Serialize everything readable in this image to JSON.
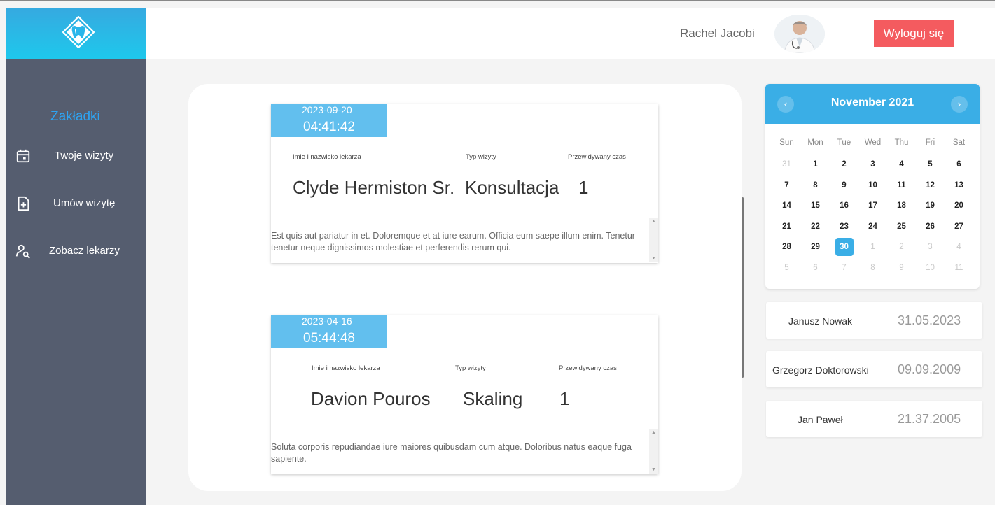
{
  "header": {
    "user_name": "Rachel Jacobi",
    "logout_label": "Wyloguj się"
  },
  "sidebar": {
    "title": "Zakładki",
    "items": [
      {
        "label": "Twoje wizyty",
        "icon": "calendar-icon"
      },
      {
        "label": "Umów wizytę",
        "icon": "file-add-icon"
      },
      {
        "label": "Zobacz lekarzy",
        "icon": "user-search-icon"
      }
    ]
  },
  "visits": [
    {
      "date": "2023-09-20",
      "time": "04:41:42",
      "doctor_header": "Imie i nazwisko lekarza",
      "type_header": "Typ wizyty",
      "duration_header": "Przewidywany czas",
      "doctor": "Clyde Hermiston Sr.",
      "type": "Konsultacja",
      "duration": "1",
      "description": "Est quis aut pariatur in et. Doloremque et at iure earum. Officia eum saepe illum enim. Tenetur tenetur neque dignissimos molestiae et perferendis rerum qui."
    },
    {
      "date": "2023-04-16",
      "time": "05:44:48",
      "doctor_header": "Imie i nazwisko lekarza",
      "type_header": "Typ wizyty",
      "duration_header": "Przewidywany czas",
      "doctor": "Davion Pouros",
      "type": "Skaling",
      "duration": "1",
      "description": "Soluta corporis repudiandae iure maiores quibusdam cum atque. Doloribus natus eaque fuga sapiente."
    }
  ],
  "calendar": {
    "title": "November 2021",
    "weekdays": [
      "Sun",
      "Mon",
      "Tue",
      "Wed",
      "Thu",
      "Fri",
      "Sat"
    ],
    "weeks": [
      [
        "31",
        "1",
        "2",
        "3",
        "4",
        "5",
        "6"
      ],
      [
        "7",
        "8",
        "9",
        "10",
        "11",
        "12",
        "13"
      ],
      [
        "14",
        "15",
        "16",
        "17",
        "18",
        "19",
        "20"
      ],
      [
        "21",
        "22",
        "23",
        "24",
        "25",
        "26",
        "27"
      ],
      [
        "28",
        "29",
        "30",
        "1",
        "2",
        "3",
        "4"
      ],
      [
        "5",
        "6",
        "7",
        "8",
        "9",
        "10",
        "11"
      ]
    ],
    "selected": "30",
    "accent_color": "#3aaee6"
  },
  "upcoming": [
    {
      "name": "Janusz Nowak",
      "date": "31.05.2023"
    },
    {
      "name": "Grzegorz Doktorowski",
      "date": "09.09.2009"
    },
    {
      "name": "Jan Paweł",
      "date": "21.37.2005"
    }
  ],
  "colors": {
    "sidebar_bg": "#555d6f",
    "logout_bg": "#f45b5f",
    "date_badge_bg": "#62bfee",
    "link_blue": "#2ea4f2"
  }
}
